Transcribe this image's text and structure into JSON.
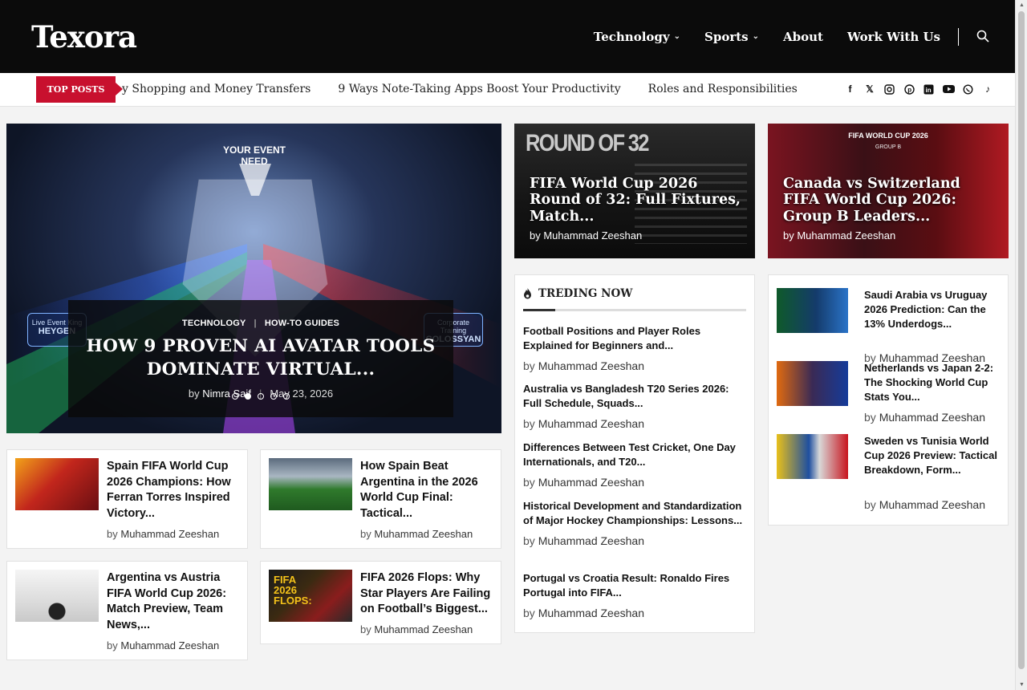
{
  "site": {
    "logo": "Texora"
  },
  "nav": {
    "items": [
      {
        "label": "Technology",
        "has_dropdown": true
      },
      {
        "label": "Sports",
        "has_dropdown": true
      },
      {
        "label": "About",
        "has_dropdown": false
      },
      {
        "label": "Work With Us",
        "has_dropdown": false
      }
    ],
    "search_icon": "search-icon"
  },
  "ticker": {
    "label": "TOP POSTS",
    "items": [
      "y Shopping and Money Transfers",
      "9 Ways Note-Taking Apps Boost Your Productivity",
      "Roles and Responsibilities of Cri"
    ]
  },
  "socials": [
    "facebook-icon",
    "x-icon",
    "instagram-icon",
    "pinterest-icon",
    "linkedin-icon",
    "youtube-icon",
    "whatsapp-icon",
    "tiktok-icon"
  ],
  "hero": {
    "overlay_text": "YOUR EVENT\nNEED",
    "badge_left": {
      "small": "Live Event King",
      "big": "HEYGEN"
    },
    "badge_right": {
      "small": "Corporate Training",
      "big": "COLOSSYAN"
    },
    "categories": [
      "TECHNOLOGY",
      "HOW-TO GUIDES"
    ],
    "title": "HOW 9 PROVEN AI AVATAR TOOLS DOMINATE VIRTUAL...",
    "by": "by",
    "author": "Nimra Saif",
    "date": "May 23, 2026",
    "slide_count": 5,
    "active_slide": 2
  },
  "featured": [
    {
      "image_text": "ROUND OF 32",
      "title": "FIFA World Cup 2026 Round of 32: Full Fixtures, Match...",
      "byline": "by Muhammad Zeeshan"
    },
    {
      "image_text": "FIFA WORLD CUP 2026",
      "image_sub": "GROUP B",
      "title": "Canada vs Switzerland FIFA World Cup 2026: Group B Leaders...",
      "byline": "by Muhammad Zeeshan"
    }
  ],
  "trending": {
    "heading": "TREDING NOW",
    "by": "by",
    "items": [
      {
        "title": "Football Positions and Player Roles Explained for Beginners and...",
        "author": "Muhammad Zeeshan"
      },
      {
        "title": "Australia vs Bangladesh T20 Series 2026: Full Schedule, Squads...",
        "author": "Muhammad Zeeshan"
      },
      {
        "title": "Differences Between Test Cricket, One Day Internationals, and T20...",
        "author": "Muhammad Zeeshan"
      },
      {
        "title": "Historical Development and Standardization of Major Hockey Championships: Lessons...",
        "author": "Muhammad Zeeshan"
      },
      {
        "title": "Portugal vs Croatia Result: Ronaldo Fires Portugal into FIFA...",
        "author": "Muhammad Zeeshan"
      }
    ]
  },
  "sidebar_posts": {
    "by": "by",
    "items": [
      {
        "title": "Saudi Arabia vs Uruguay 2026 Prediction: Can the 13% Underdogs...",
        "author": "Muhammad Zeeshan"
      },
      {
        "title": "Netherlands vs Japan 2-2: The Shocking World Cup Stats You...",
        "author": "Muhammad Zeeshan"
      },
      {
        "title": "Sweden vs Tunisia World Cup 2026 Preview: Tactical Breakdown, Form...",
        "author": "Muhammad Zeeshan"
      }
    ]
  },
  "cards": {
    "by": "by",
    "items": [
      {
        "title": "Spain FIFA World Cup 2026 Champions: How Ferran Torres Inspired Victory...",
        "author": "Muhammad Zeeshan"
      },
      {
        "title": "How Spain Beat Argentina in the 2026 World Cup Final: Tactical...",
        "author": "Muhammad Zeeshan"
      },
      {
        "title": "Argentina vs Austria FIFA World Cup 2026: Match Preview, Team News,...",
        "author": "Muhammad Zeeshan"
      },
      {
        "title": "FIFA 2026 Flops: Why Star Players Are Failing on Football’s Biggest...",
        "author": "Muhammad Zeeshan",
        "image_text": "FIFA 2026 FLOPS:"
      }
    ]
  },
  "colors": {
    "header_bg": "#0b0b0b",
    "accent_red": "#c8102e",
    "page_bg": "#f3f3f3"
  }
}
